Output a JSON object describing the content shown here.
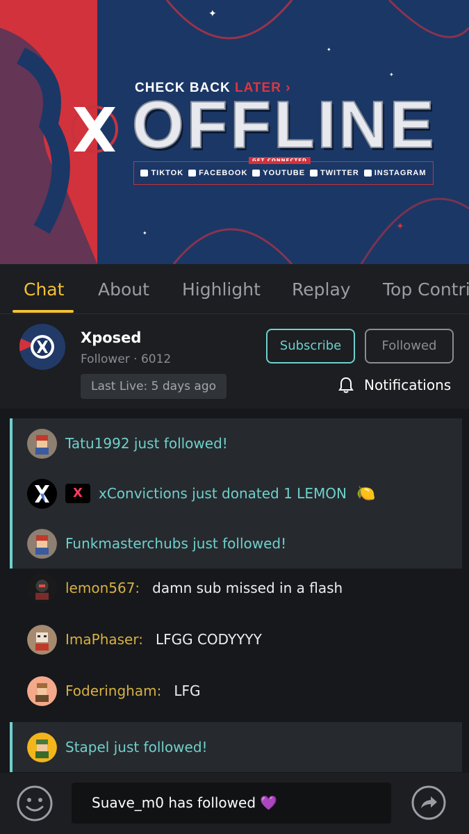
{
  "banner": {
    "check_back": "CHECK BACK",
    "later": "LATER",
    "offline": "OFFLINE",
    "get_connected": "GET CONNECTED",
    "socials": [
      "TIKTOK",
      "FACEBOOK",
      "YOUTUBE",
      "TWITTER",
      "INSTAGRAM"
    ],
    "colors": {
      "navy": "#1b3766",
      "red": "#d2323c"
    }
  },
  "tabs": [
    "Chat",
    "About",
    "Highlight",
    "Replay",
    "Top Contri"
  ],
  "active_tab": "Chat",
  "profile": {
    "name": "Xposed",
    "followers": "Follower · 6012",
    "last_live": "Last Live: 5 days ago",
    "subscribe_label": "Subscribe",
    "followed_label": "Followed",
    "notifications_label": "Notifications"
  },
  "chat": {
    "events": [
      {
        "text": "Tatu1992 just followed!",
        "avatar": "pixel-avatar-icon"
      },
      {
        "badge": "X",
        "text": "xConvictions just donated 1 LEMON",
        "emoji": "🍋",
        "avatar": "x-logo-avatar"
      },
      {
        "text": "Funkmasterchubs just followed!",
        "avatar": "pixel-avatar-icon"
      }
    ],
    "messages": [
      {
        "user": "lemon567:",
        "text": "damn sub missed in a flash"
      },
      {
        "user": "ImaPhaser:",
        "text": "LFGG CODYYYY"
      },
      {
        "user": "Foderingham:",
        "text": "LFG"
      }
    ],
    "last_event": {
      "text": "Stapel just followed!"
    }
  },
  "bottom": {
    "input_text": "Suave_m0 has followed 💜",
    "emoji_icon": "smiley-icon",
    "share_icon": "share-arrow-icon"
  },
  "colors": {
    "accent": "#f3c132",
    "teal": "#6fd0cc",
    "username": "#d8b043"
  }
}
